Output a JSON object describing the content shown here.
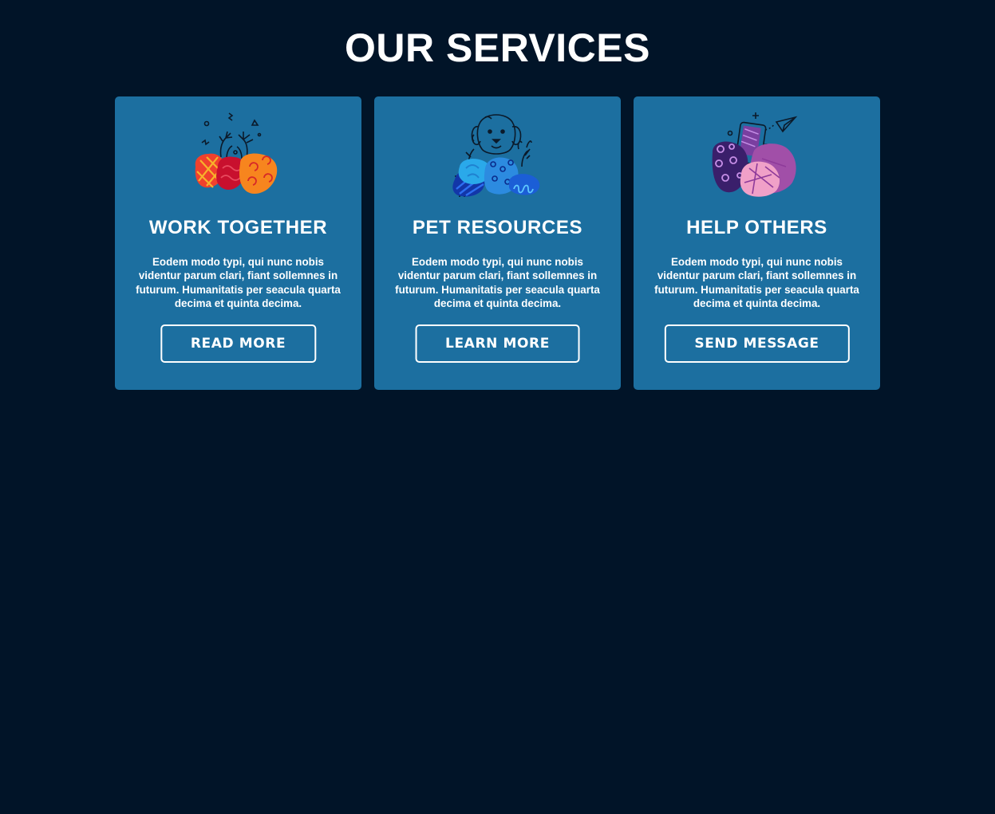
{
  "page": {
    "title": "OUR SERVICES",
    "background_color": "#011428"
  },
  "colors": {
    "card_background": "#1c6fa0",
    "text": "#ffffff"
  },
  "cards": [
    {
      "icon": "hands-together-illustration",
      "title": "WORK TOGETHER",
      "text": "Eodem modo typi, qui nunc nobis videntur parum clari, fiant sollemnes in futurum. Humanitatis per seacula quarta decima et quinta decima.",
      "button_label": "READ MORE"
    },
    {
      "icon": "dog-pet-illustration",
      "title": "PET RESOURCES",
      "text": "Eodem modo typi, qui nunc nobis videntur parum clari, fiant sollemnes in futurum. Humanitatis per seacula quarta decima et quinta decima.",
      "button_label": "LEARN MORE"
    },
    {
      "icon": "phone-paper-plane-illustration",
      "title": "HELP OTHERS",
      "text": "Eodem modo typi, qui nunc nobis videntur parum clari, fiant sollemnes in futurum. Humanitatis per seacula quarta decima et quinta decima.",
      "button_label": "SEND MESSAGE"
    }
  ]
}
